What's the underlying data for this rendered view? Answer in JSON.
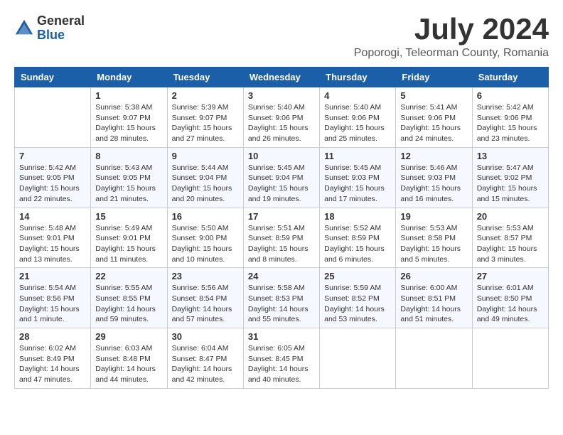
{
  "header": {
    "logo": {
      "general": "General",
      "blue": "Blue"
    },
    "month": "July 2024",
    "location": "Poporogi, Teleorman County, Romania"
  },
  "weekdays": [
    "Sunday",
    "Monday",
    "Tuesday",
    "Wednesday",
    "Thursday",
    "Friday",
    "Saturday"
  ],
  "weeks": [
    [
      {
        "day": "",
        "info": ""
      },
      {
        "day": "1",
        "info": "Sunrise: 5:38 AM\nSunset: 9:07 PM\nDaylight: 15 hours\nand 28 minutes."
      },
      {
        "day": "2",
        "info": "Sunrise: 5:39 AM\nSunset: 9:07 PM\nDaylight: 15 hours\nand 27 minutes."
      },
      {
        "day": "3",
        "info": "Sunrise: 5:40 AM\nSunset: 9:06 PM\nDaylight: 15 hours\nand 26 minutes."
      },
      {
        "day": "4",
        "info": "Sunrise: 5:40 AM\nSunset: 9:06 PM\nDaylight: 15 hours\nand 25 minutes."
      },
      {
        "day": "5",
        "info": "Sunrise: 5:41 AM\nSunset: 9:06 PM\nDaylight: 15 hours\nand 24 minutes."
      },
      {
        "day": "6",
        "info": "Sunrise: 5:42 AM\nSunset: 9:06 PM\nDaylight: 15 hours\nand 23 minutes."
      }
    ],
    [
      {
        "day": "7",
        "info": "Sunrise: 5:42 AM\nSunset: 9:05 PM\nDaylight: 15 hours\nand 22 minutes."
      },
      {
        "day": "8",
        "info": "Sunrise: 5:43 AM\nSunset: 9:05 PM\nDaylight: 15 hours\nand 21 minutes."
      },
      {
        "day": "9",
        "info": "Sunrise: 5:44 AM\nSunset: 9:04 PM\nDaylight: 15 hours\nand 20 minutes."
      },
      {
        "day": "10",
        "info": "Sunrise: 5:45 AM\nSunset: 9:04 PM\nDaylight: 15 hours\nand 19 minutes."
      },
      {
        "day": "11",
        "info": "Sunrise: 5:45 AM\nSunset: 9:03 PM\nDaylight: 15 hours\nand 17 minutes."
      },
      {
        "day": "12",
        "info": "Sunrise: 5:46 AM\nSunset: 9:03 PM\nDaylight: 15 hours\nand 16 minutes."
      },
      {
        "day": "13",
        "info": "Sunrise: 5:47 AM\nSunset: 9:02 PM\nDaylight: 15 hours\nand 15 minutes."
      }
    ],
    [
      {
        "day": "14",
        "info": "Sunrise: 5:48 AM\nSunset: 9:01 PM\nDaylight: 15 hours\nand 13 minutes."
      },
      {
        "day": "15",
        "info": "Sunrise: 5:49 AM\nSunset: 9:01 PM\nDaylight: 15 hours\nand 11 minutes."
      },
      {
        "day": "16",
        "info": "Sunrise: 5:50 AM\nSunset: 9:00 PM\nDaylight: 15 hours\nand 10 minutes."
      },
      {
        "day": "17",
        "info": "Sunrise: 5:51 AM\nSunset: 8:59 PM\nDaylight: 15 hours\nand 8 minutes."
      },
      {
        "day": "18",
        "info": "Sunrise: 5:52 AM\nSunset: 8:59 PM\nDaylight: 15 hours\nand 6 minutes."
      },
      {
        "day": "19",
        "info": "Sunrise: 5:53 AM\nSunset: 8:58 PM\nDaylight: 15 hours\nand 5 minutes."
      },
      {
        "day": "20",
        "info": "Sunrise: 5:53 AM\nSunset: 8:57 PM\nDaylight: 15 hours\nand 3 minutes."
      }
    ],
    [
      {
        "day": "21",
        "info": "Sunrise: 5:54 AM\nSunset: 8:56 PM\nDaylight: 15 hours\nand 1 minute."
      },
      {
        "day": "22",
        "info": "Sunrise: 5:55 AM\nSunset: 8:55 PM\nDaylight: 14 hours\nand 59 minutes."
      },
      {
        "day": "23",
        "info": "Sunrise: 5:56 AM\nSunset: 8:54 PM\nDaylight: 14 hours\nand 57 minutes."
      },
      {
        "day": "24",
        "info": "Sunrise: 5:58 AM\nSunset: 8:53 PM\nDaylight: 14 hours\nand 55 minutes."
      },
      {
        "day": "25",
        "info": "Sunrise: 5:59 AM\nSunset: 8:52 PM\nDaylight: 14 hours\nand 53 minutes."
      },
      {
        "day": "26",
        "info": "Sunrise: 6:00 AM\nSunset: 8:51 PM\nDaylight: 14 hours\nand 51 minutes."
      },
      {
        "day": "27",
        "info": "Sunrise: 6:01 AM\nSunset: 8:50 PM\nDaylight: 14 hours\nand 49 minutes."
      }
    ],
    [
      {
        "day": "28",
        "info": "Sunrise: 6:02 AM\nSunset: 8:49 PM\nDaylight: 14 hours\nand 47 minutes."
      },
      {
        "day": "29",
        "info": "Sunrise: 6:03 AM\nSunset: 8:48 PM\nDaylight: 14 hours\nand 44 minutes."
      },
      {
        "day": "30",
        "info": "Sunrise: 6:04 AM\nSunset: 8:47 PM\nDaylight: 14 hours\nand 42 minutes."
      },
      {
        "day": "31",
        "info": "Sunrise: 6:05 AM\nSunset: 8:45 PM\nDaylight: 14 hours\nand 40 minutes."
      },
      {
        "day": "",
        "info": ""
      },
      {
        "day": "",
        "info": ""
      },
      {
        "day": "",
        "info": ""
      }
    ]
  ]
}
